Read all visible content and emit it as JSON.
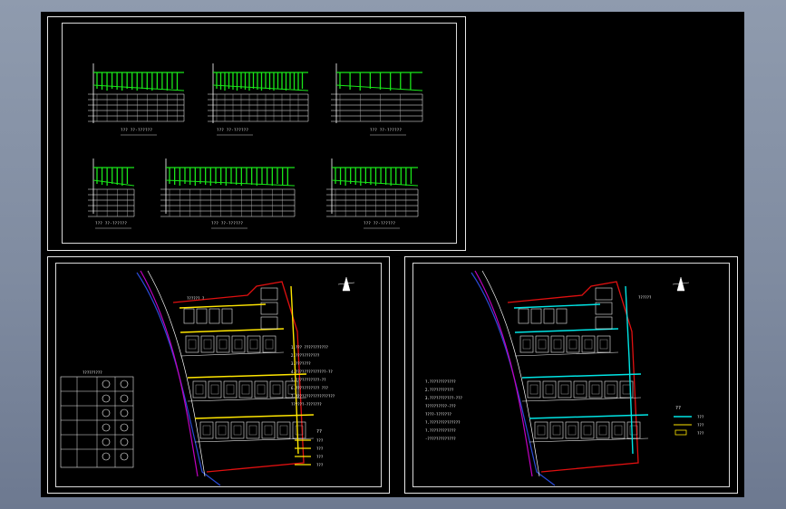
{
  "colors": {
    "background_gradient": [
      "#8f9bae",
      "#6d7990"
    ],
    "model_space": "#000000",
    "frame": "#e8e8e8",
    "profile_green": "#19e619",
    "water_yellow": "#ffe600",
    "road_magenta": "#c000c0",
    "boundary_red": "#e01010",
    "pipe_cyan": "#00e5e5",
    "river_blue": "#2a4bd8"
  },
  "top_sheet": {
    "profiles": [
      {
        "caption": "??? ??-??????"
      },
      {
        "caption": "??? ??-??????"
      },
      {
        "caption": "??? ??-??????"
      },
      {
        "caption": "??? ??-??????"
      },
      {
        "caption": "??? ??-??????"
      },
      {
        "caption": "??? ??-??????"
      }
    ]
  },
  "left_plan": {
    "road_label": "?????? ?",
    "legend_title": "?????????",
    "legend_bottom_title": "??",
    "notes": [
      "1.??? ???????????",
      "2.???????????",
      "3.???????",
      "4.??????????????-??",
      "5.???????????-??",
      "6.??????????? ???",
      "7.??????????????????",
      "??????-???????"
    ],
    "legend_items": [
      "???",
      "???",
      "???",
      "???"
    ]
  },
  "right_plan": {
    "road_label": "??????",
    "legend_bottom_title": "??",
    "notes": [
      "?.????????????",
      "2.???????????",
      "3.???????????-???",
      "??????????-???",
      "????-???????",
      "?.??????????????",
      "?.????????????",
      "-?????????????"
    ],
    "legend_items": [
      "???",
      "???",
      "???"
    ]
  }
}
